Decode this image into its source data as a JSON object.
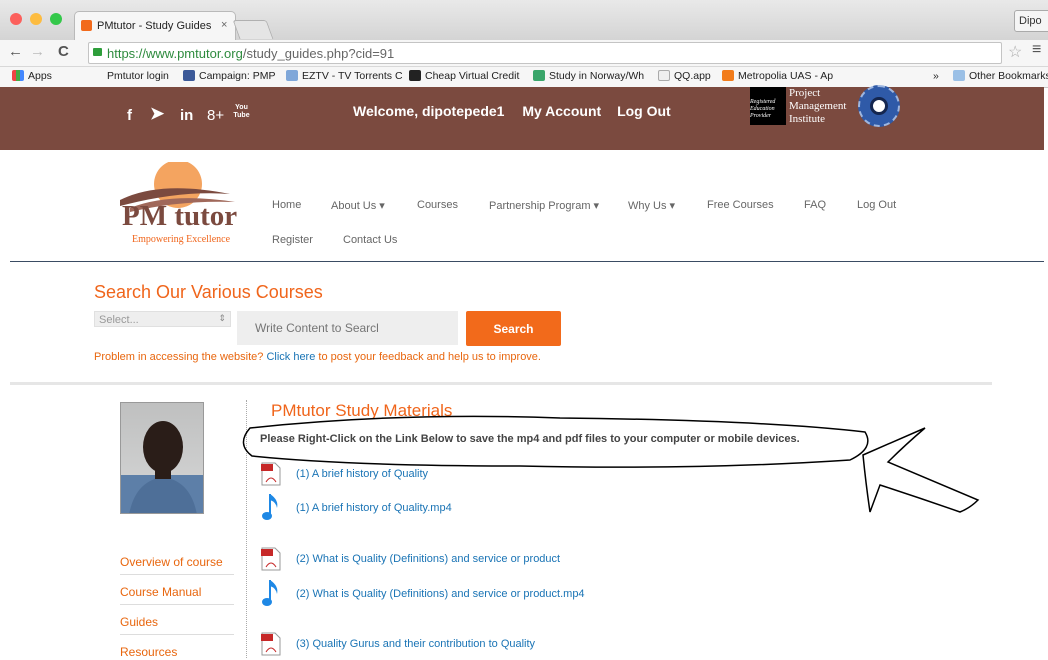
{
  "browser": {
    "tab_title": "PMtutor - Study Guides",
    "tab_close": "×",
    "profile": "Dipo",
    "url_prefix": "https://www.pmtutor.org",
    "url_rest": "/study_guides.php?cid=91",
    "bookmarks": [
      "Apps",
      "Pmtutor login",
      "Campaign: PMP",
      "EZTV - TV Torrents C",
      "Cheap Virtual Credit",
      "Study in Norway/Wh",
      "QQ.app",
      "Metropolia UAS - Ap",
      "»",
      "Other Bookmarks"
    ]
  },
  "header": {
    "social": [
      "f",
      "in",
      "8+",
      "You Tube"
    ],
    "welcome": "Welcome, dipotepede1",
    "my_account": "My Account",
    "logout": "Log Out",
    "pmi_badge": "Registered Education Provider",
    "pmi_name": [
      "Project",
      "Management",
      "Institute"
    ]
  },
  "logo": {
    "name": "PM tutor",
    "tagline": "Empowering Excellence"
  },
  "nav": {
    "items": [
      "Home",
      "About Us ▾",
      "Courses",
      "Partnership Program ▾",
      "Why Us ▾",
      "Free Courses",
      "FAQ",
      "Log Out",
      "Register",
      "Contact Us"
    ]
  },
  "search": {
    "title": "Search Our Various Courses",
    "select_value": "Select...",
    "placeholder": "Write Content to Searcl",
    "button": "Search",
    "problem_pre": "Problem in accessing the website?",
    "problem_link": "Click here",
    "problem_post": "to post your feedback and help us to improve."
  },
  "sidebar": {
    "links": [
      "Overview of course",
      "Course Manual",
      "Guides",
      "Resources"
    ]
  },
  "materials": {
    "title": "PMtutor Study Materials",
    "notice": "Please Right-Click on the Link Below to save the mp4 and pdf files to your computer or mobile devices.",
    "items": [
      {
        "type": "pdf",
        "label": "(1) A brief history of Quality"
      },
      {
        "type": "mp4",
        "label": "(1) A brief history of Quality.mp4"
      },
      {
        "type": "pdf",
        "label": "(2) What is Quality (Definitions) and service or product"
      },
      {
        "type": "mp4",
        "label": "(2) What is Quality (Definitions) and service or product.mp4"
      },
      {
        "type": "pdf",
        "label": "(3) Quality Gurus and their contribution to Quality"
      }
    ]
  },
  "colors": {
    "brand_orange": "#f0651b",
    "header_brown": "#7b4a3f",
    "link_blue": "#1a74b5"
  }
}
